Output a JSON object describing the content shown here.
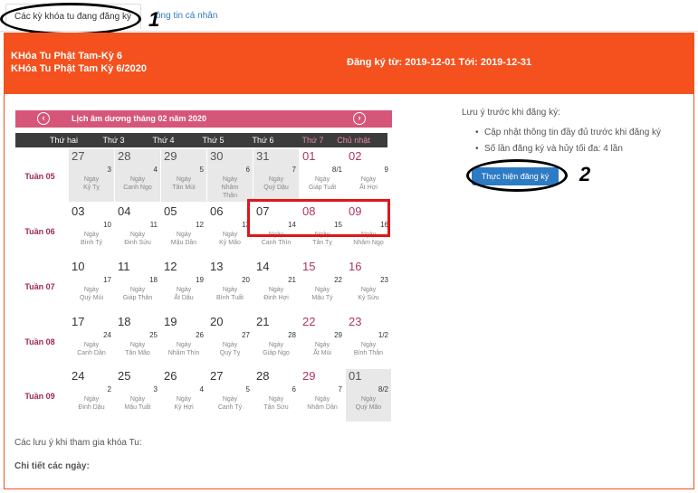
{
  "tabs": [
    {
      "label": "Các kỳ khóa tu đang đăng ký"
    },
    {
      "label": "ông tin cá nhân"
    }
  ],
  "annotations": {
    "step1": "1",
    "step2": "2"
  },
  "header": {
    "title1": "KHóa Tu Phật Tam-Kỳ 6",
    "title2": "KHóa Tu Phật Tam Kỳ 6/2020",
    "registration": "Đăng ký từ: 2019-12-01 Tới: 2019-12-31"
  },
  "calendar": {
    "title": "Lịch âm dương tháng 02 năm 2020",
    "prev_icon": "‹",
    "next_icon": "›",
    "day_headers": [
      "Thứ hai",
      "Thứ 3",
      "Thứ 4",
      "Thứ 5",
      "Thứ 6",
      "Thứ 7",
      "Chủ nhật"
    ],
    "weeks": [
      {
        "label": "Tuần 05",
        "days": [
          {
            "solar": "27",
            "lunar": "3",
            "l1": "Ngày",
            "l2": "Kỷ Tỵ",
            "l3": "",
            "grey": true,
            "red": false
          },
          {
            "solar": "28",
            "lunar": "4",
            "l1": "Ngày",
            "l2": "Canh Ngọ",
            "l3": "",
            "grey": true,
            "red": false
          },
          {
            "solar": "29",
            "lunar": "5",
            "l1": "Ngày",
            "l2": "Tân Mùi",
            "l3": "",
            "grey": true,
            "red": false
          },
          {
            "solar": "30",
            "lunar": "6",
            "l1": "Ngày",
            "l2": "Nhâm",
            "l3": "Thân",
            "grey": true,
            "red": false
          },
          {
            "solar": "31",
            "lunar": "7",
            "l1": "Ngày",
            "l2": "Quý Dậu",
            "l3": "",
            "grey": true,
            "red": false
          },
          {
            "solar": "01",
            "lunar": "8/1",
            "l1": "Ngày",
            "l2": "Giáp Tuất",
            "l3": "",
            "grey": false,
            "red": true
          },
          {
            "solar": "02",
            "lunar": "9",
            "l1": "Ngày",
            "l2": "Ất Hợi",
            "l3": "",
            "grey": false,
            "red": true
          }
        ]
      },
      {
        "label": "Tuần 06",
        "days": [
          {
            "solar": "03",
            "lunar": "10",
            "l1": "Ngày",
            "l2": "Bính Tý",
            "l3": "",
            "grey": false,
            "red": false
          },
          {
            "solar": "04",
            "lunar": "11",
            "l1": "Ngày",
            "l2": "Đinh Sửu",
            "l3": "",
            "grey": false,
            "red": false
          },
          {
            "solar": "05",
            "lunar": "12",
            "l1": "Ngày",
            "l2": "Mậu Dần",
            "l3": "",
            "grey": false,
            "red": false
          },
          {
            "solar": "06",
            "lunar": "13",
            "l1": "Ngày",
            "l2": "Kỷ Mão",
            "l3": "",
            "grey": false,
            "red": false
          },
          {
            "solar": "07",
            "lunar": "14",
            "l1": "Ngày",
            "l2": "Canh Thìn",
            "l3": "",
            "grey": false,
            "red": false
          },
          {
            "solar": "08",
            "lunar": "15",
            "l1": "Ngày",
            "l2": "Tân Tỵ",
            "l3": "",
            "grey": false,
            "red": true
          },
          {
            "solar": "09",
            "lunar": "16",
            "l1": "Ngày",
            "l2": "Nhâm Ngọ",
            "l3": "",
            "grey": false,
            "red": true
          }
        ]
      },
      {
        "label": "Tuần 07",
        "days": [
          {
            "solar": "10",
            "lunar": "17",
            "l1": "Ngày",
            "l2": "Quý Mùi",
            "l3": "",
            "grey": false,
            "red": false
          },
          {
            "solar": "11",
            "lunar": "18",
            "l1": "Ngày",
            "l2": "Giáp Thân",
            "l3": "",
            "grey": false,
            "red": false
          },
          {
            "solar": "12",
            "lunar": "19",
            "l1": "Ngày",
            "l2": "Ất Dậu",
            "l3": "",
            "grey": false,
            "red": false
          },
          {
            "solar": "13",
            "lunar": "20",
            "l1": "Ngày",
            "l2": "Bính Tuất",
            "l3": "",
            "grey": false,
            "red": false
          },
          {
            "solar": "14",
            "lunar": "21",
            "l1": "Ngày",
            "l2": "Đinh Hợi",
            "l3": "",
            "grey": false,
            "red": false
          },
          {
            "solar": "15",
            "lunar": "22",
            "l1": "Ngày",
            "l2": "Mậu Tý",
            "l3": "",
            "grey": false,
            "red": true
          },
          {
            "solar": "16",
            "lunar": "23",
            "l1": "Ngày",
            "l2": "Kỷ Sửu",
            "l3": "",
            "grey": false,
            "red": true
          }
        ]
      },
      {
        "label": "Tuần 08",
        "days": [
          {
            "solar": "17",
            "lunar": "24",
            "l1": "Ngày",
            "l2": "Canh Dần",
            "l3": "",
            "grey": false,
            "red": false
          },
          {
            "solar": "18",
            "lunar": "25",
            "l1": "Ngày",
            "l2": "Tân Mão",
            "l3": "",
            "grey": false,
            "red": false
          },
          {
            "solar": "19",
            "lunar": "26",
            "l1": "Ngày",
            "l2": "Nhâm Thìn",
            "l3": "",
            "grey": false,
            "red": false
          },
          {
            "solar": "20",
            "lunar": "27",
            "l1": "Ngày",
            "l2": "Quý Tỵ",
            "l3": "",
            "grey": false,
            "red": false
          },
          {
            "solar": "21",
            "lunar": "28",
            "l1": "Ngày",
            "l2": "Giáp Ngọ",
            "l3": "",
            "grey": false,
            "red": false
          },
          {
            "solar": "22",
            "lunar": "29",
            "l1": "Ngày",
            "l2": "Ất Mùi",
            "l3": "",
            "grey": false,
            "red": true
          },
          {
            "solar": "23",
            "lunar": "1/2",
            "l1": "Ngày",
            "l2": "Bính Thân",
            "l3": "",
            "grey": false,
            "red": true
          }
        ]
      },
      {
        "label": "Tuần 09",
        "days": [
          {
            "solar": "24",
            "lunar": "2",
            "l1": "Ngày",
            "l2": "Đinh Dậu",
            "l3": "",
            "grey": false,
            "red": false
          },
          {
            "solar": "25",
            "lunar": "3",
            "l1": "Ngày",
            "l2": "Mậu Tuất",
            "l3": "",
            "grey": false,
            "red": false
          },
          {
            "solar": "26",
            "lunar": "4",
            "l1": "Ngày",
            "l2": "Kỷ Hợi",
            "l3": "",
            "grey": false,
            "red": false
          },
          {
            "solar": "27",
            "lunar": "5",
            "l1": "Ngày",
            "l2": "Canh Tý",
            "l3": "",
            "grey": false,
            "red": false
          },
          {
            "solar": "28",
            "lunar": "6",
            "l1": "Ngày",
            "l2": "Tân Sửu",
            "l3": "",
            "grey": false,
            "red": false
          },
          {
            "solar": "29",
            "lunar": "7",
            "l1": "Ngày",
            "l2": "Nhâm Dần",
            "l3": "",
            "grey": false,
            "red": true
          },
          {
            "solar": "01",
            "lunar": "8/2",
            "l1": "Ngày",
            "l2": "Quý Mão",
            "l3": "",
            "grey": true,
            "red": false
          }
        ]
      }
    ]
  },
  "notes": {
    "title": "Lưu ý trước khi đăng ký:",
    "items": [
      "Cập nhật thông tin đầy đủ trước khi đăng ký",
      "Số lần đăng ký và hủy tối đa: 4 lần"
    ]
  },
  "register_button": "Thực hiện đăng ký",
  "footer": {
    "notes_label": "Các lưu ý khi tham gia khóa Tu:",
    "details_label": "Chi tiết các ngày:"
  },
  "colors": {
    "header_bg": "#f4511e",
    "calendar_title_bg": "#d6567a",
    "day_header_bg": "#3c3c3c",
    "button_bg": "#2d7bc4",
    "highlight_box": "#e0161b"
  }
}
